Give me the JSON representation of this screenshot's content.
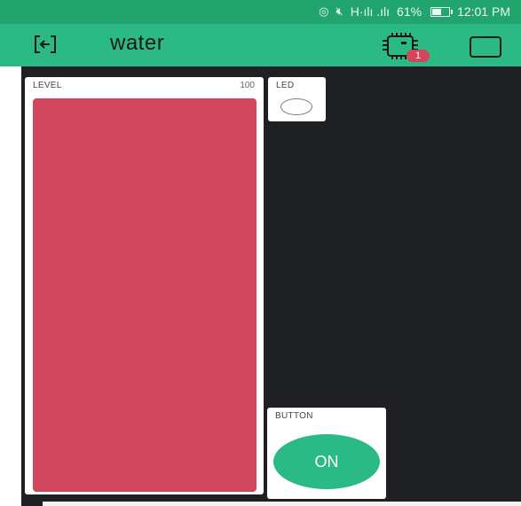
{
  "status_bar": {
    "signal_text": "H·ılı .ılı",
    "battery_percent": "61%",
    "battery_level": 0.61,
    "time": "12:01 PM",
    "icons": [
      "hotspot-icon",
      "mute-icon",
      "signal-icon",
      "battery-icon"
    ]
  },
  "toolbar": {
    "title": "water",
    "device_badge": "1",
    "icons": [
      "back-icon",
      "device-icon",
      "square-icon"
    ]
  },
  "widgets": {
    "level": {
      "label": "LEVEL",
      "max": "100",
      "value_fraction": 1.0,
      "color": "#d1465c"
    },
    "led": {
      "label": "LED",
      "state": "off"
    },
    "button": {
      "label": "BUTTON",
      "state_text": "ON",
      "color": "#2bb985"
    }
  },
  "colors": {
    "status_bar": "#22a46e",
    "toolbar": "#2bb985",
    "canvas": "#1e2023"
  }
}
